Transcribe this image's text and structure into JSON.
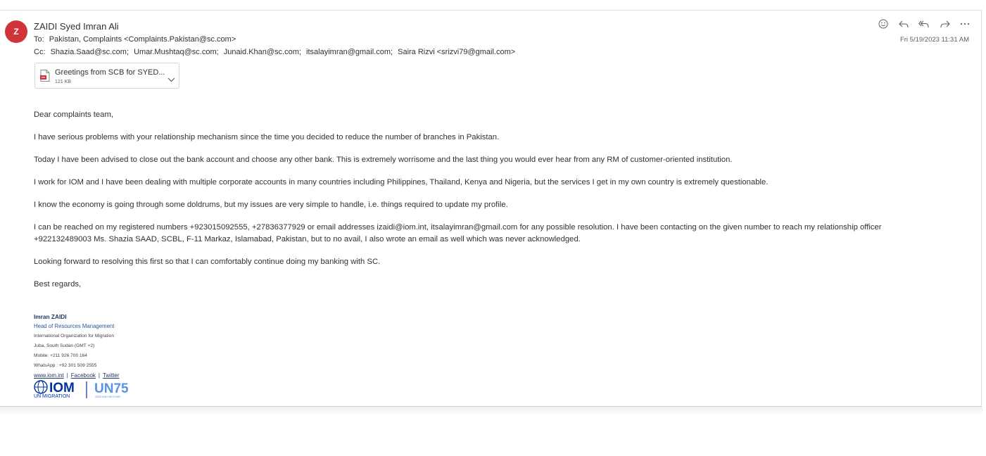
{
  "email": {
    "avatar_initial": "Z",
    "sender": "ZAIDI Syed Imran Ali",
    "to_label": "To:",
    "to_value": "Pakistan, Complaints <Complaints.Pakistan@sc.com>",
    "cc_label": "Cc:",
    "cc": [
      "Shazia.Saad@sc.com;",
      "Umar.Mushtaq@sc.com;",
      "Junaid.Khan@sc.com;",
      "itsalayimran@gmail.com;",
      "Saira Rizvi <srizvi79@gmail.com>"
    ],
    "date": "Fri 5/19/2023 11:31 AM"
  },
  "actions": [
    {
      "name": "emoji-reaction-icon",
      "glyph": "smiley"
    },
    {
      "name": "reply-icon",
      "glyph": "reply"
    },
    {
      "name": "reply-all-icon",
      "glyph": "reply-all"
    },
    {
      "name": "forward-icon",
      "glyph": "forward"
    },
    {
      "name": "more-actions-icon",
      "glyph": "ellipsis"
    }
  ],
  "attachment": {
    "name": "Greetings from SCB for SYED...",
    "size": "121 KB",
    "icon": "pdf-file-icon"
  },
  "body": {
    "greeting": "Dear complaints team,",
    "p1": "I have serious problems with your relationship mechanism since the time you decided to reduce the number of branches in Pakistan.",
    "p2": "Today I have been advised to close out the bank account and choose any other bank. This is extremely worrisome and the last thing you would ever hear from any RM of customer-oriented institution.",
    "p3": "I work for IOM and I have been dealing with multiple corporate accounts in many countries including Philippines, Thailand, Kenya and Nigeria, but the services I get in my own country is extremely questionable.",
    "p4": "I know the economy is going through some doldrums, but my issues are very simple to handle, i.e. things required to update my profile.",
    "p5a": "I can be reached on my registered numbers +923015092555, +27836377929 or email addresses izaidi@iom.int, itsalayimran@gmail.com for any possible resolution. I have been contacting on the given number to reach my relationship officer",
    "p5b": "+922132489003 Ms. Shazia SAAD, SCBL, F-11 Markaz, Islamabad, Pakistan, but to no avail, I also wrote an email as well which was never acknowledged.",
    "p6": "Looking forward to resolving this first so that I can comfortably continue doing my banking with SC.",
    "closing": "Best regards,"
  },
  "signature": {
    "name": "Imran ZAIDI",
    "title": "Head of Resources Management",
    "org": "International Organization for Migration",
    "location": "Juba, South Sudan (GMT +2)",
    "mobile": "Mobile: +211 926 700 164",
    "whatsapp": "WhatsApp : +92 301 509 2555",
    "link_web": "www.iom.int",
    "link_sep": "|",
    "link_facebook": "Facebook",
    "link_twitter": "Twitter",
    "logo_iom": "IOM",
    "logo_iom_sub": "UN MIGRATION",
    "logo_un": "UN75",
    "logo_un_sub": "2020 AND BEYOND"
  },
  "colors": {
    "avatar": "#d13438",
    "signature_navy": "#1f3864",
    "logo_blue": "#0033a0"
  }
}
